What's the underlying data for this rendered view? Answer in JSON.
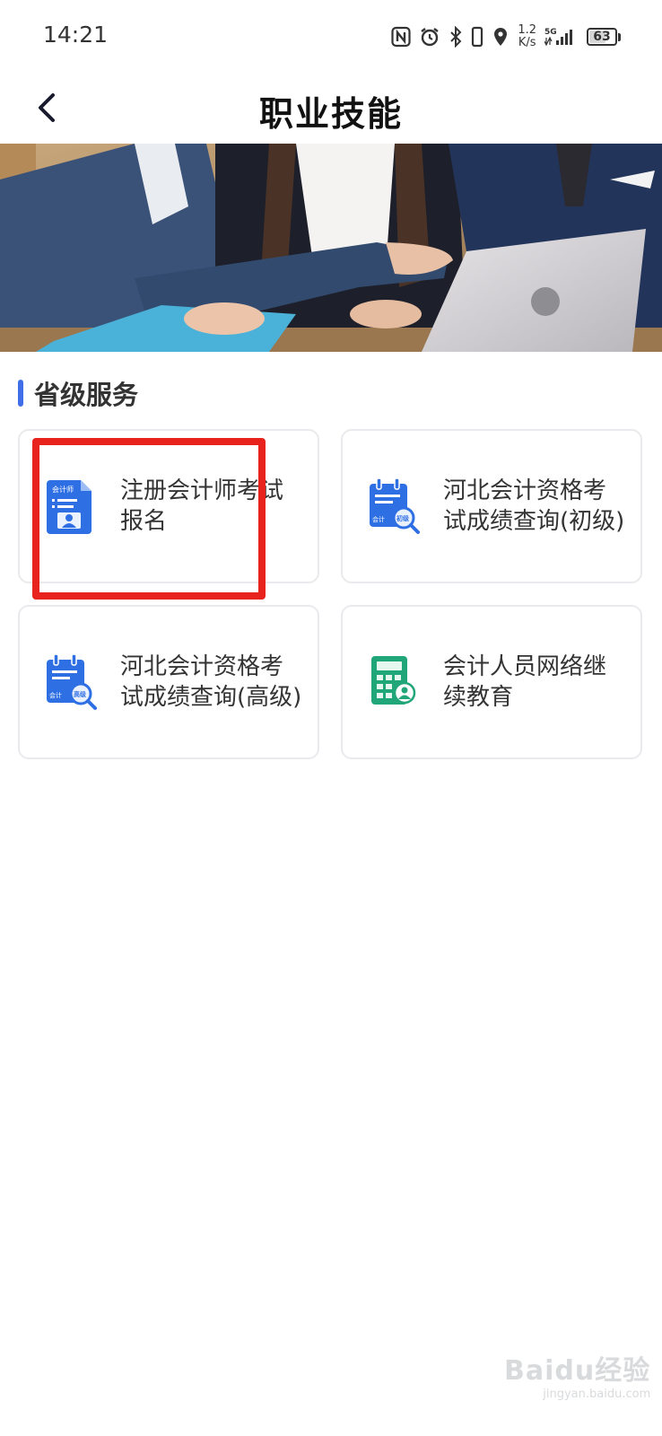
{
  "status_bar": {
    "time": "14:21",
    "network_speed_value": "1.2",
    "network_speed_unit": "K/s",
    "network_type": "5G",
    "battery": "63",
    "icons": [
      "nfc-icon",
      "alarm-icon",
      "bluetooth-icon",
      "vibrate-icon",
      "location-icon",
      "signal-icon",
      "battery-icon"
    ]
  },
  "nav": {
    "title": "职业技能",
    "back_icon": "chevron-left-icon"
  },
  "section": {
    "title": "省级服务",
    "accent_color": "#3f6ee8"
  },
  "services": [
    {
      "label": "注册会计师考试报名",
      "icon": "cpa-id-card-icon",
      "icon_text": "会计师"
    },
    {
      "label": "河北会计资格考试成绩查询(初级)",
      "icon": "calendar-search-icon",
      "icon_text": "会计",
      "badge": "初级"
    },
    {
      "label": "河北会计资格考试成绩查询(高级)",
      "icon": "calendar-search-icon",
      "icon_text": "会计",
      "badge": "高级"
    },
    {
      "label": "会计人员网络继续教育",
      "icon": "calculator-user-icon"
    }
  ],
  "highlight_color": "#e8221c",
  "watermark": {
    "main": "Baidu经验",
    "sub": "jingyan.baidu.com"
  }
}
